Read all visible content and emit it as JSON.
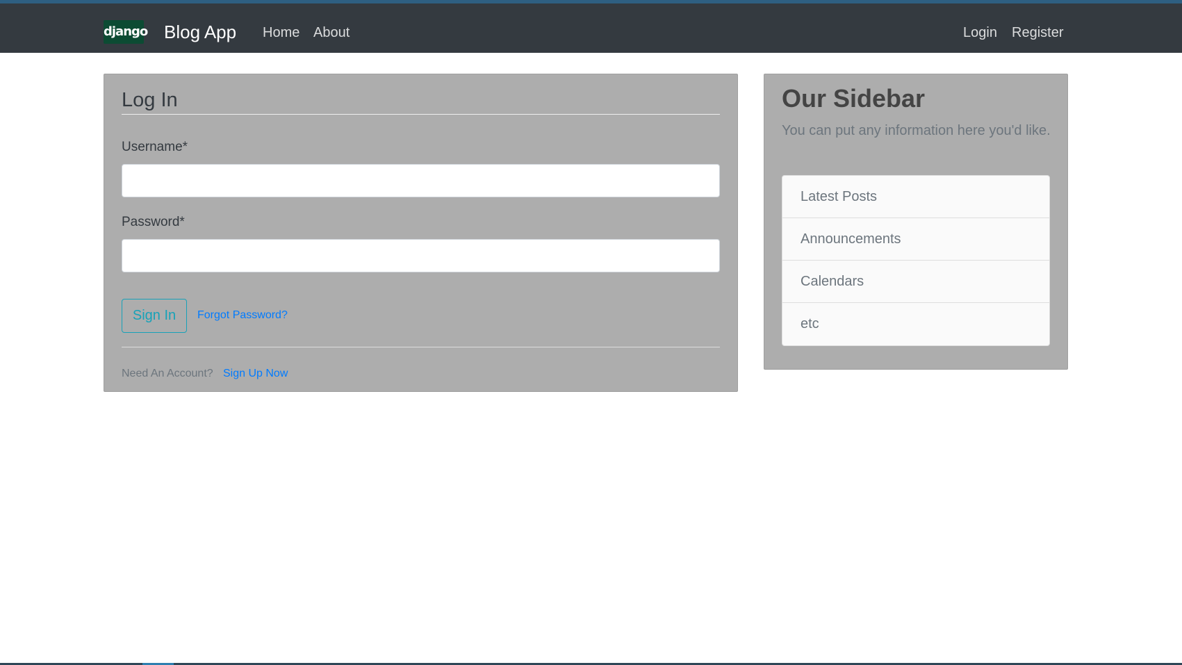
{
  "navbar": {
    "logo_text": "django",
    "brand": "Blog App",
    "links": [
      "Home",
      "About"
    ],
    "auth_links": [
      "Login",
      "Register"
    ]
  },
  "login": {
    "title": "Log In",
    "username_label": "Username*",
    "username_value": "",
    "password_label": "Password*",
    "password_value": "",
    "submit_label": "Sign In",
    "forgot_label": "Forgot Password?",
    "need_account_text": "Need An Account?",
    "signup_label": "Sign Up Now"
  },
  "sidebar": {
    "title": "Our Sidebar",
    "text": "You can put any information here you'd like.",
    "items": [
      "Latest Posts",
      "Announcements",
      "Calendars",
      "etc"
    ]
  },
  "colors": {
    "navbar": "#343a40",
    "card": "#adadad",
    "link": "#007bff",
    "button_outline": "#17a2b8",
    "logo_bg": "#0c4b33"
  }
}
